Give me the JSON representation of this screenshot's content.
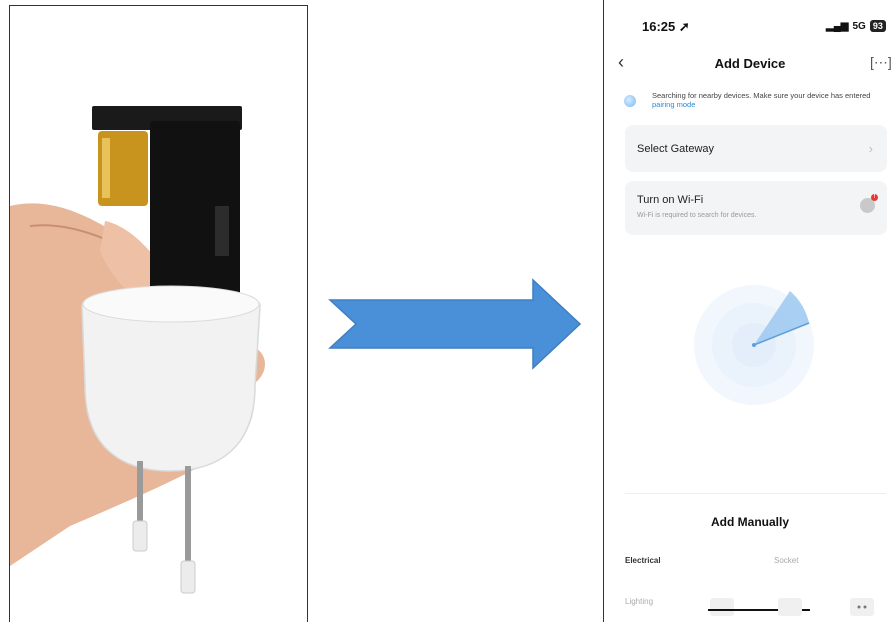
{
  "phone": {
    "status_bar": {
      "time": "16:25",
      "signal": "5G",
      "battery": "93"
    },
    "nav": {
      "title": "Add Device"
    },
    "search_notice": {
      "text": "Searching for nearby devices. Make sure your device has entered",
      "link": "pairing mode"
    },
    "cards": {
      "gateway": {
        "title": "Select Gateway"
      },
      "wifi": {
        "title": "Turn on Wi-Fi",
        "subtitle": "Wi-Fi is required to search for devices.",
        "badge": "!"
      }
    },
    "manual": {
      "title": "Add Manually",
      "categories": [
        "Electrical",
        "Socket",
        "Lighting"
      ]
    }
  },
  "icons": [
    "back-chevron-icon",
    "scan-icon",
    "location-arrow-icon",
    "signal-icon",
    "battery-icon",
    "chevron-right-icon",
    "wifi-toggle-icon",
    "radar-icon",
    "right-arrow-icon"
  ],
  "colors": {
    "arrow": "#4a90d9",
    "link": "#2a8bd6",
    "radar": "#9cc8f0",
    "badge": "#e53935"
  }
}
